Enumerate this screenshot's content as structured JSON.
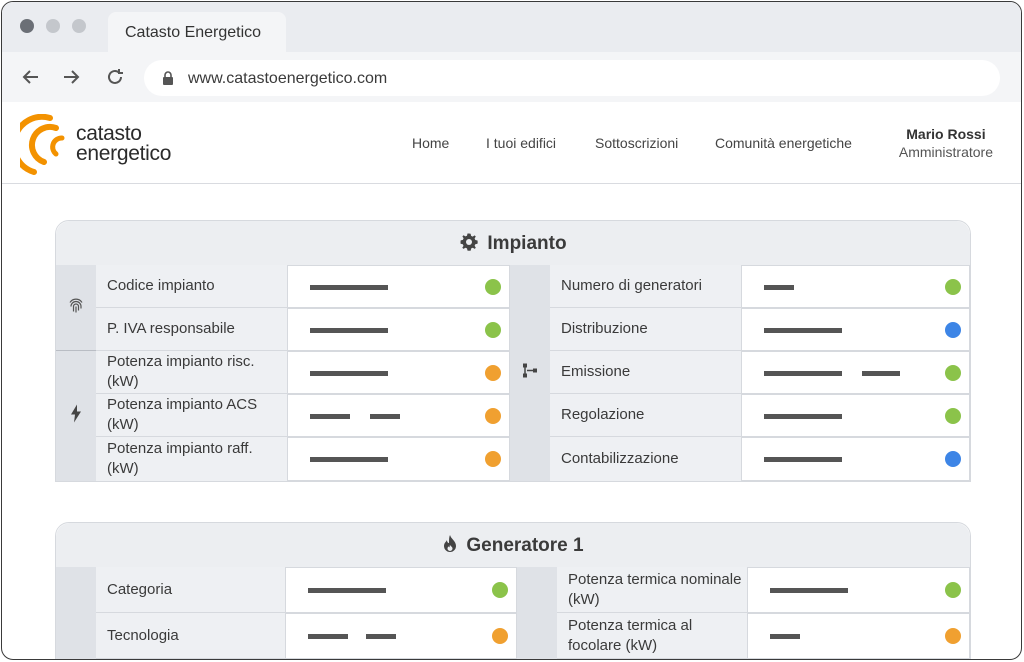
{
  "browser": {
    "tab_title": "Catasto Energetico",
    "url": "www.catastoenergetico.com",
    "back_icon": "arrow-left-icon",
    "forward_icon": "arrow-right-icon",
    "reload_icon": "reload-icon",
    "lock_icon": "lock-icon"
  },
  "header": {
    "logo_line1": "catasto",
    "logo_line2": "energetico",
    "brand_color": "#f39200",
    "nav": [
      "Home",
      "I tuoi edifici",
      "Sottoscrizioni",
      "Comunità energetiche"
    ],
    "user_name": "Mario Rossi",
    "user_role": "Amministratore"
  },
  "status_colors": {
    "ok": "#8bc34a",
    "warning": "#f0a030",
    "info": "#3d85e6"
  },
  "impianto": {
    "title": "Impianto",
    "icon": "gear-icon",
    "left_groups": [
      {
        "icon": "fingerprint-icon",
        "rows": [
          {
            "label": "Codice impianto",
            "status": "ok"
          },
          {
            "label": "P. IVA responsabile",
            "status": "ok"
          }
        ]
      },
      {
        "icon": "lightning-icon",
        "rows": [
          {
            "label": "Potenza impianto risc. (kW)",
            "status": "warning"
          },
          {
            "label": "Potenza impianto ACS (kW)",
            "status": "warning"
          },
          {
            "label": "Potenza impianto raff. (kW)",
            "status": "warning"
          }
        ]
      }
    ],
    "right_group": {
      "icon": "hierarchy-icon",
      "rows": [
        {
          "label": "Numero di generatori",
          "status": "ok"
        },
        {
          "label": "Distribuzione",
          "status": "info"
        },
        {
          "label": "Emissione",
          "status": "ok"
        },
        {
          "label": "Regolazione",
          "status": "ok"
        },
        {
          "label": "Contabilizzazione",
          "status": "info"
        }
      ]
    }
  },
  "generatore": {
    "title": "Generatore 1",
    "icon": "flame-icon",
    "left_rows": [
      {
        "label": "Categoria",
        "status": "ok"
      },
      {
        "label": "Tecnologia",
        "status": "warning"
      }
    ],
    "right_rows": [
      {
        "label": "Potenza termica nominale (kW)",
        "status": "ok"
      },
      {
        "label": "Potenza termica al focolare (kW)",
        "status": "warning"
      }
    ]
  }
}
